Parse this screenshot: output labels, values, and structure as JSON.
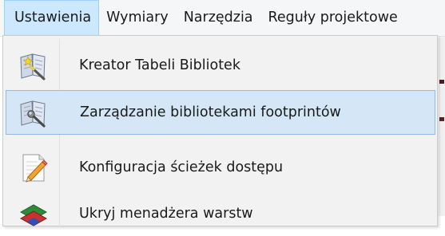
{
  "menubar": {
    "items": [
      {
        "label": "Ustawienia",
        "active": true
      },
      {
        "label": "Wymiary"
      },
      {
        "label": "Narzędzia"
      },
      {
        "label": "Reguły projektowe"
      }
    ]
  },
  "dropdown": {
    "items": [
      {
        "label": "Kreator Tabeli Bibliotek",
        "icon": "book-wand-icon"
      },
      {
        "label": "Zarządzanie bibliotekami footprintów",
        "icon": "book-wrench-icon",
        "highlighted": true
      },
      {
        "label": "Konfiguracja ścieżek dostępu",
        "icon": "notepad-pencil-icon"
      },
      {
        "label": "Ukryj menadżera warstw",
        "icon": "layers-manager-icon"
      }
    ]
  }
}
